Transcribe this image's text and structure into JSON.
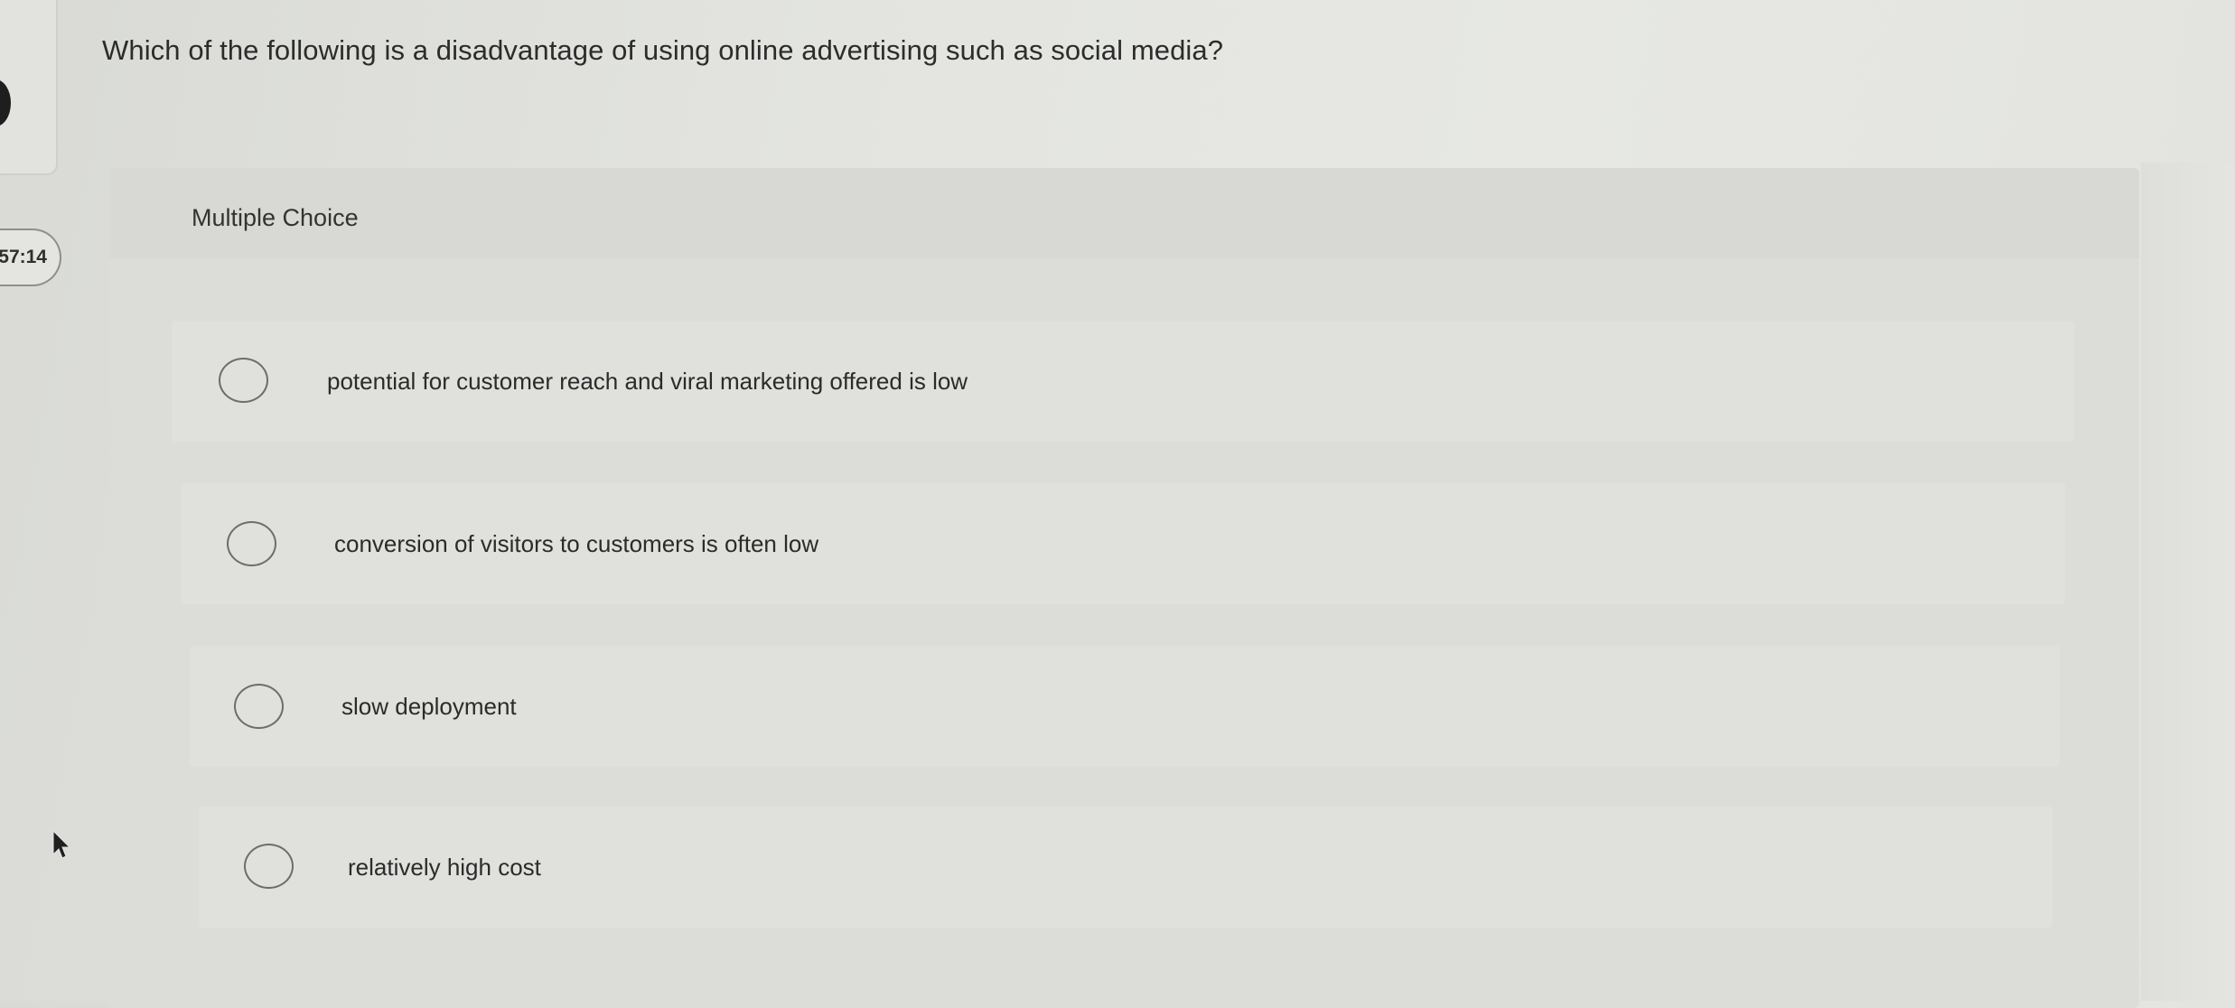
{
  "timer": {
    "value": "57:14"
  },
  "question": {
    "text": "Which of the following is a disadvantage of using online advertising such as social media?"
  },
  "answer_section": {
    "type_label": "Multiple Choice",
    "options": [
      {
        "label": "potential for customer reach and viral marketing offered is low",
        "selected": false
      },
      {
        "label": "conversion of visitors to customers is often low",
        "selected": false
      },
      {
        "label": "slow deployment",
        "selected": false
      },
      {
        "label": "relatively high cost",
        "selected": false
      }
    ]
  },
  "icons": {
    "cursor": "mouse-pointer-icon",
    "radio": "radio-button-icon"
  }
}
